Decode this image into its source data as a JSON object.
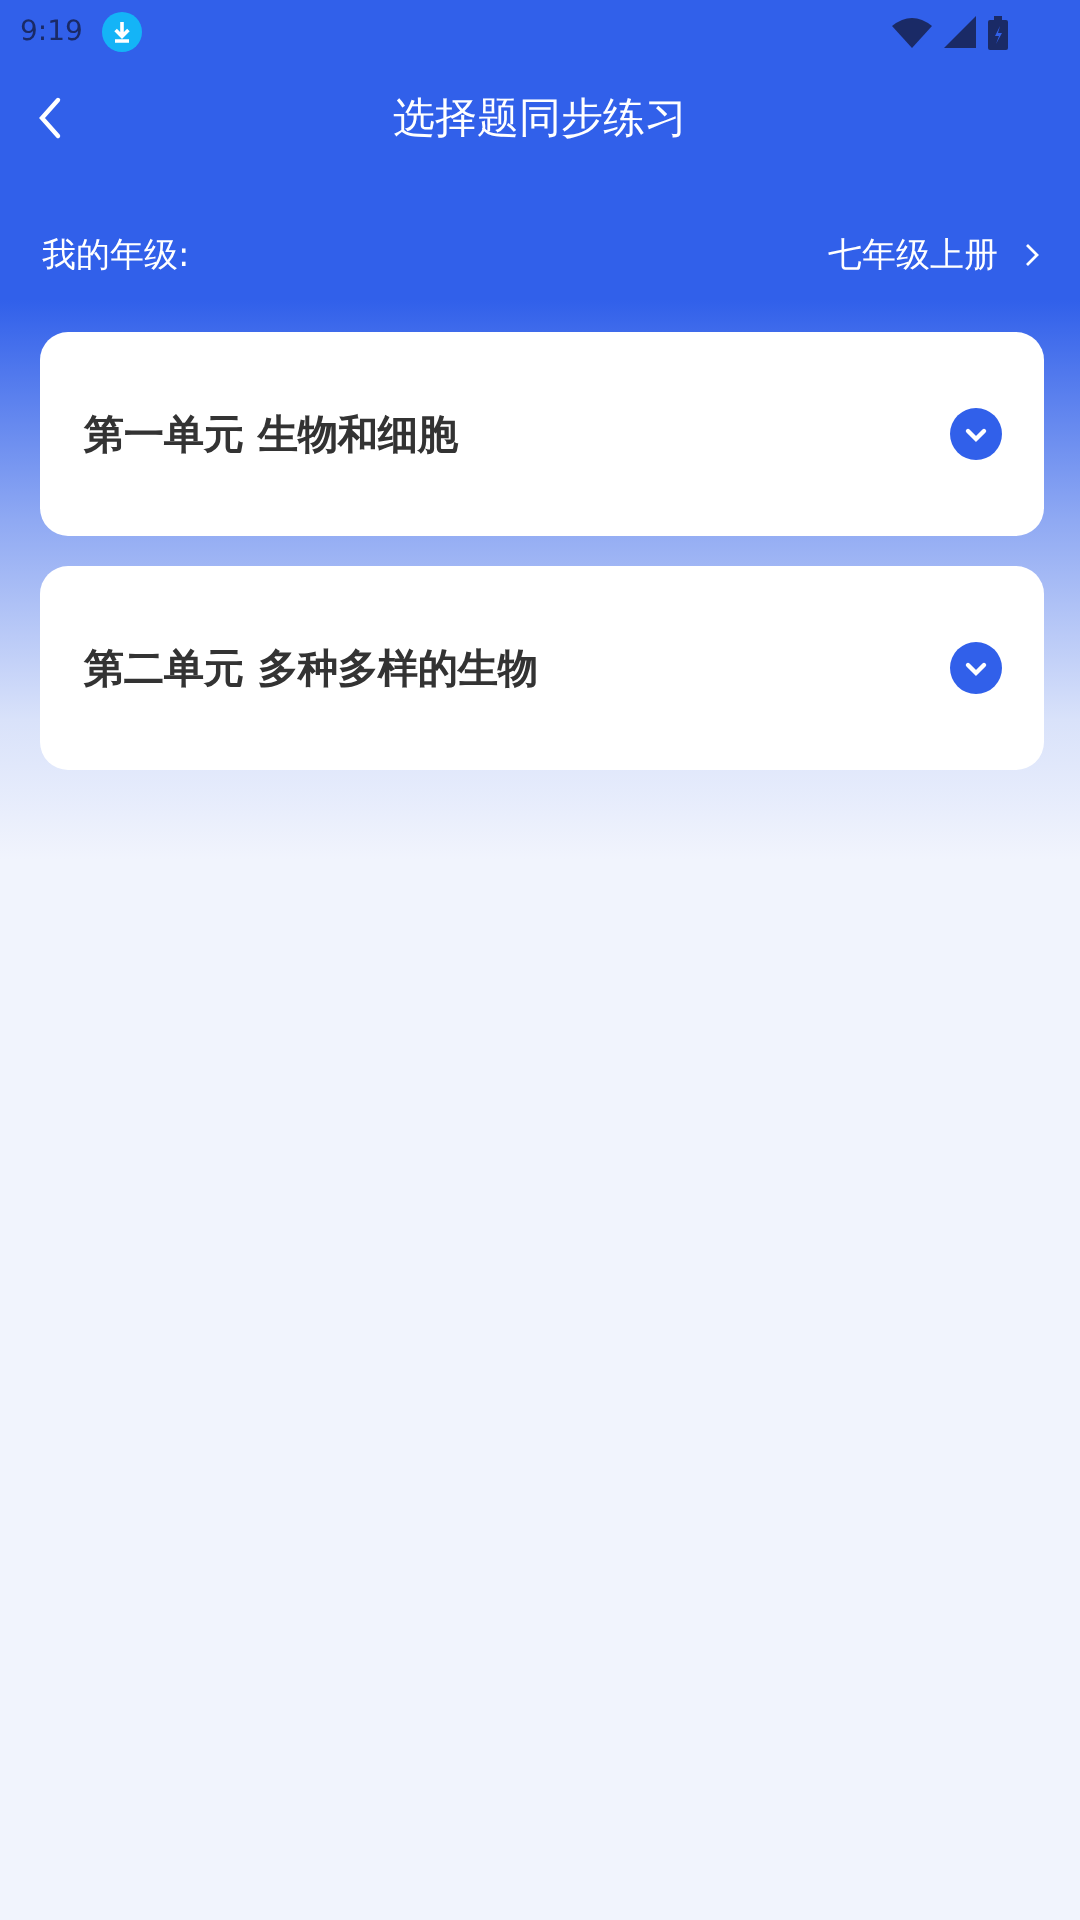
{
  "status_bar": {
    "time": "9:19"
  },
  "header": {
    "title": "选择题同步练习"
  },
  "grade": {
    "label": "我的年级:",
    "value": "七年级上册"
  },
  "units": [
    {
      "title": "第一单元 生物和细胞",
      "expanded": false
    },
    {
      "title": "第二单元 多种多样的生物",
      "expanded": false
    }
  ]
}
